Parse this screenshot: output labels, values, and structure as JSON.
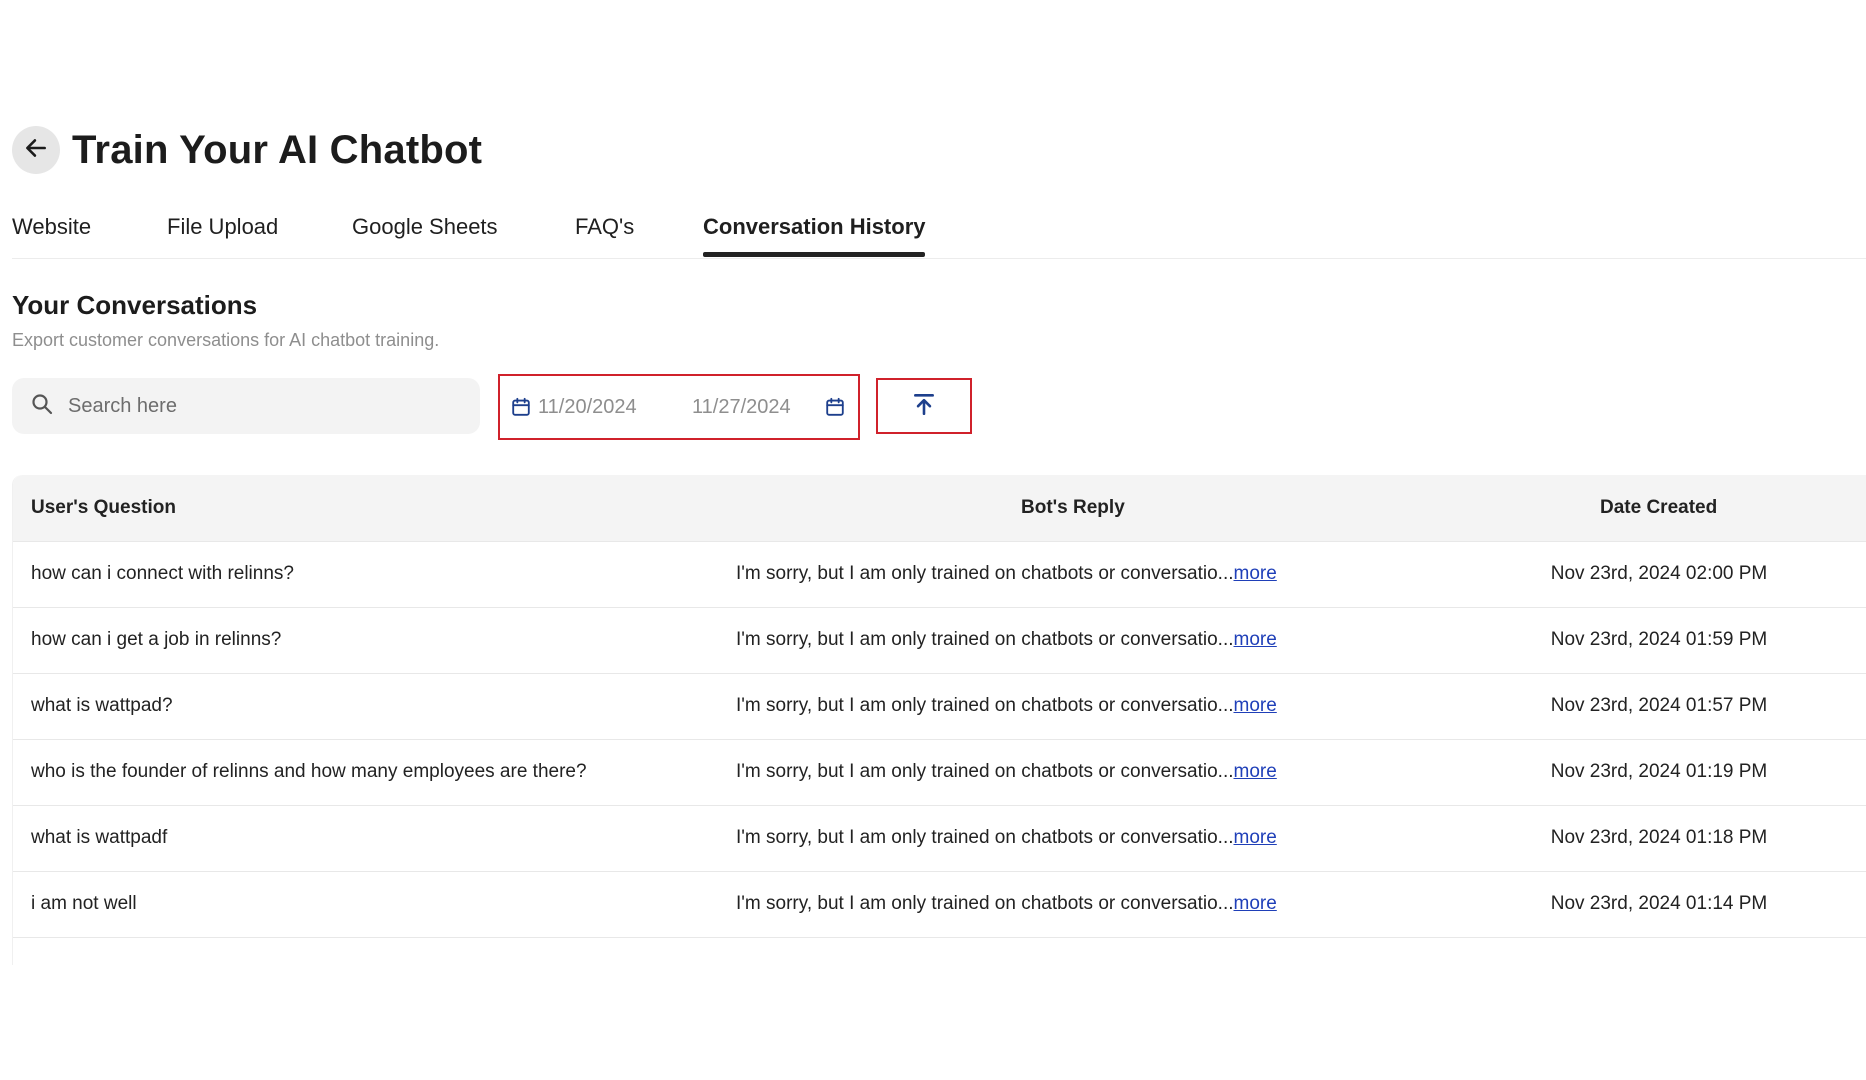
{
  "header": {
    "title": "Train Your AI Chatbot",
    "back_icon": "arrow-left-icon"
  },
  "tabs": [
    {
      "label": "Website",
      "active": false
    },
    {
      "label": "File Upload",
      "active": false
    },
    {
      "label": "Google Sheets",
      "active": false
    },
    {
      "label": "FAQ's",
      "active": false
    },
    {
      "label": "Conversation History",
      "active": true
    }
  ],
  "section": {
    "title": "Your Conversations",
    "subtitle": "Export customer conversations for AI chatbot training."
  },
  "filters": {
    "search_placeholder": "Search here",
    "date_start": "11/20/2024",
    "date_end": "11/27/2024",
    "export_icon": "upload-icon"
  },
  "table": {
    "columns": [
      "User's Question",
      "Bot's Reply",
      "Date Created"
    ],
    "more_label": "more",
    "rows": [
      {
        "question": "how can i connect with relinns?",
        "reply": "I'm sorry, but I am only trained on chatbots or conversatio...",
        "date": "Nov 23rd, 2024 02:00 PM"
      },
      {
        "question": "how can i get a job in relinns?",
        "reply": "I'm sorry, but I am only trained on chatbots or conversatio...",
        "date": "Nov 23rd, 2024 01:59 PM"
      },
      {
        "question": "what is wattpad?",
        "reply": "I'm sorry, but I am only trained on chatbots or conversatio...",
        "date": "Nov 23rd, 2024 01:57 PM"
      },
      {
        "question": "who is the founder of relinns and how many employees are there?",
        "reply": "I'm sorry, but I am only trained on chatbots or conversatio...",
        "date": "Nov 23rd, 2024 01:19 PM"
      },
      {
        "question": "what is wattpadf",
        "reply": "I'm sorry, but I am only trained on chatbots or conversatio...",
        "date": "Nov 23rd, 2024 01:18 PM"
      },
      {
        "question": "i am not well",
        "reply": "I'm sorry, but I am only trained on chatbots or conversatio...",
        "date": "Nov 23rd, 2024 01:14 PM"
      }
    ]
  },
  "colors": {
    "highlight_border": "#d0212b",
    "link": "#1f3fb8",
    "export_icon": "#1d3f8c"
  }
}
